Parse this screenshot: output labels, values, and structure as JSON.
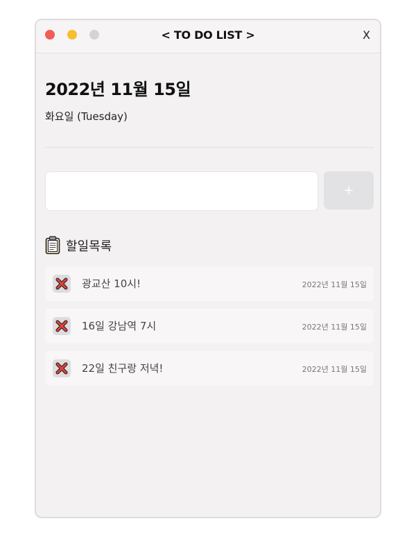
{
  "window": {
    "title": "< TO DO LIST >",
    "close_label": "X"
  },
  "header": {
    "date": "2022년 11월 15일",
    "weekday": "화요일 (Tuesday)"
  },
  "input": {
    "value": "",
    "placeholder": "",
    "add_label": "+"
  },
  "list": {
    "icon": "clipboard-icon",
    "title": "할일목록",
    "items": [
      {
        "text": "광교산 10시!",
        "date": "2022년 11월 15일",
        "delete_icon": "cross-mark-icon"
      },
      {
        "text": "16일 강남역 7시",
        "date": "2022년 11월 15일",
        "delete_icon": "cross-mark-icon"
      },
      {
        "text": "22일 친구랑 저녁!",
        "date": "2022년 11월 15일",
        "delete_icon": "cross-mark-icon"
      }
    ]
  },
  "colors": {
    "close_dot": "#f15e54",
    "minimize_dot": "#f7be32",
    "zoom_dot": "#d4d4d6",
    "add_button": "#e2e2e5",
    "delete_mark": "#e0443a"
  }
}
